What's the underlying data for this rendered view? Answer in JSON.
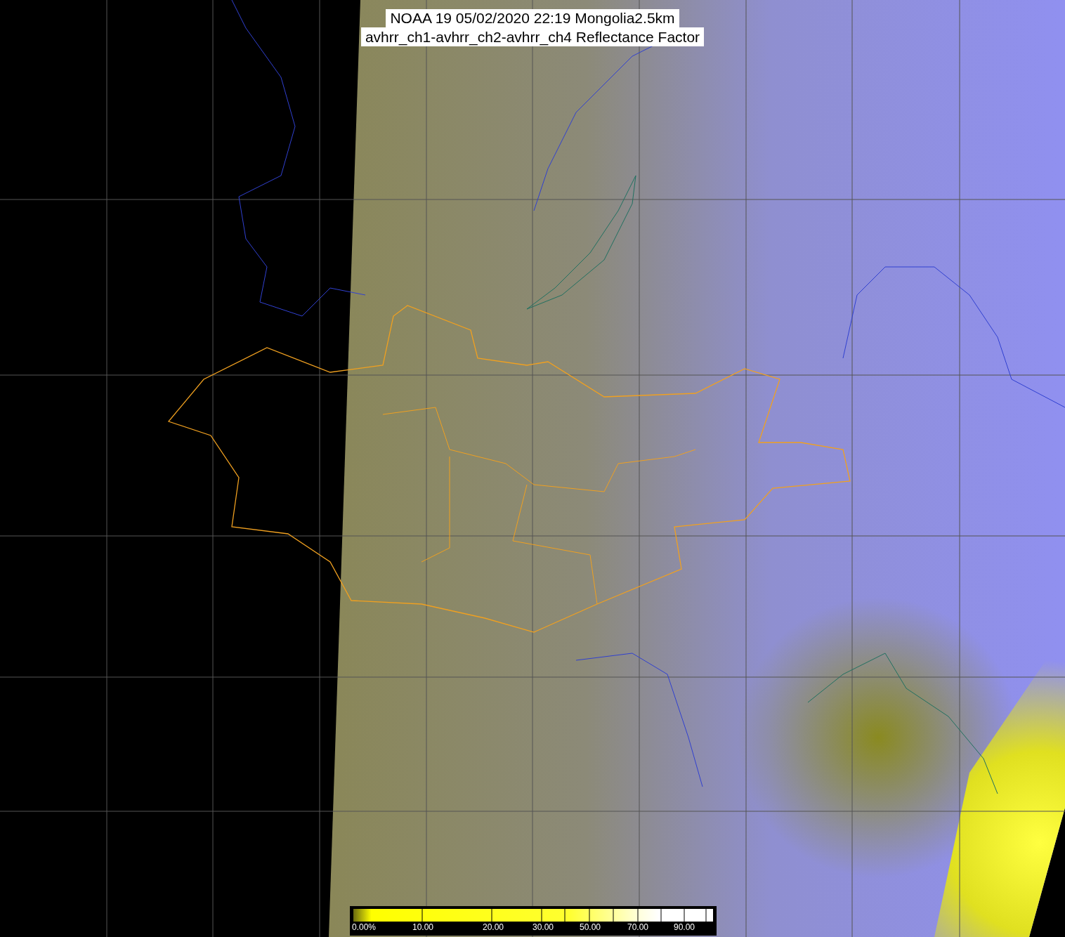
{
  "title_lines": [
    "NOAA 19 05/02/2020 22:19 Mongolia2.5km",
    "avhrr_ch1-avhrr_ch2-avhrr_ch4 Reflectance Factor"
  ],
  "colorbar": {
    "tick_labels": [
      "0.00%",
      "10.00",
      "20.00",
      "30.00",
      "50.00",
      "70.00",
      "90.00"
    ]
  }
}
